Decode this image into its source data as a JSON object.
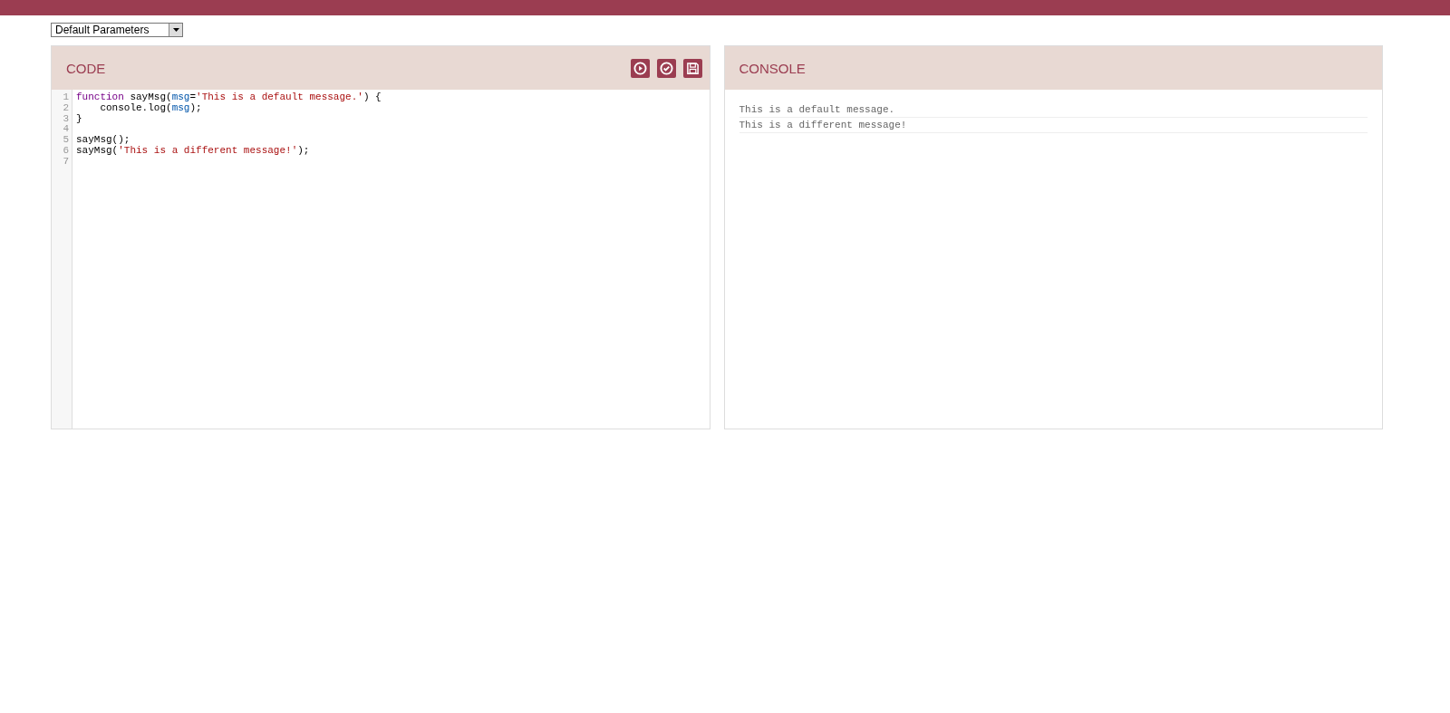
{
  "preset_select": {
    "value": "Default Parameters"
  },
  "code_panel": {
    "title": "CODE",
    "actions": [
      {
        "kind": "run"
      },
      {
        "kind": "check"
      },
      {
        "kind": "save"
      }
    ],
    "lines": [
      {
        "number": "1",
        "tokens": [
          {
            "kind": "keyword",
            "text": "function"
          },
          {
            "kind": "plain",
            "text": " sayMsg("
          },
          {
            "kind": "variable",
            "text": "msg"
          },
          {
            "kind": "plain",
            "text": "="
          },
          {
            "kind": "string",
            "text": "'This is a default message.'"
          },
          {
            "kind": "plain",
            "text": ") {"
          }
        ]
      },
      {
        "number": "2",
        "tokens": [
          {
            "kind": "plain",
            "text": "    console.log("
          },
          {
            "kind": "variable",
            "text": "msg"
          },
          {
            "kind": "plain",
            "text": ");"
          }
        ]
      },
      {
        "number": "3",
        "tokens": [
          {
            "kind": "plain",
            "text": "}"
          }
        ]
      },
      {
        "number": "4"
      },
      {
        "number": "5",
        "tokens": [
          {
            "kind": "plain",
            "text": "sayMsg();"
          }
        ]
      },
      {
        "number": "6",
        "tokens": [
          {
            "kind": "plain",
            "text": "sayMsg("
          },
          {
            "kind": "string",
            "text": "'This is a different message!'"
          },
          {
            "kind": "plain",
            "text": ");"
          }
        ]
      },
      {
        "number": "7"
      }
    ]
  },
  "console_panel": {
    "title": "CONSOLE",
    "entries": [
      "This is a default message.",
      "This is a different message!"
    ]
  }
}
